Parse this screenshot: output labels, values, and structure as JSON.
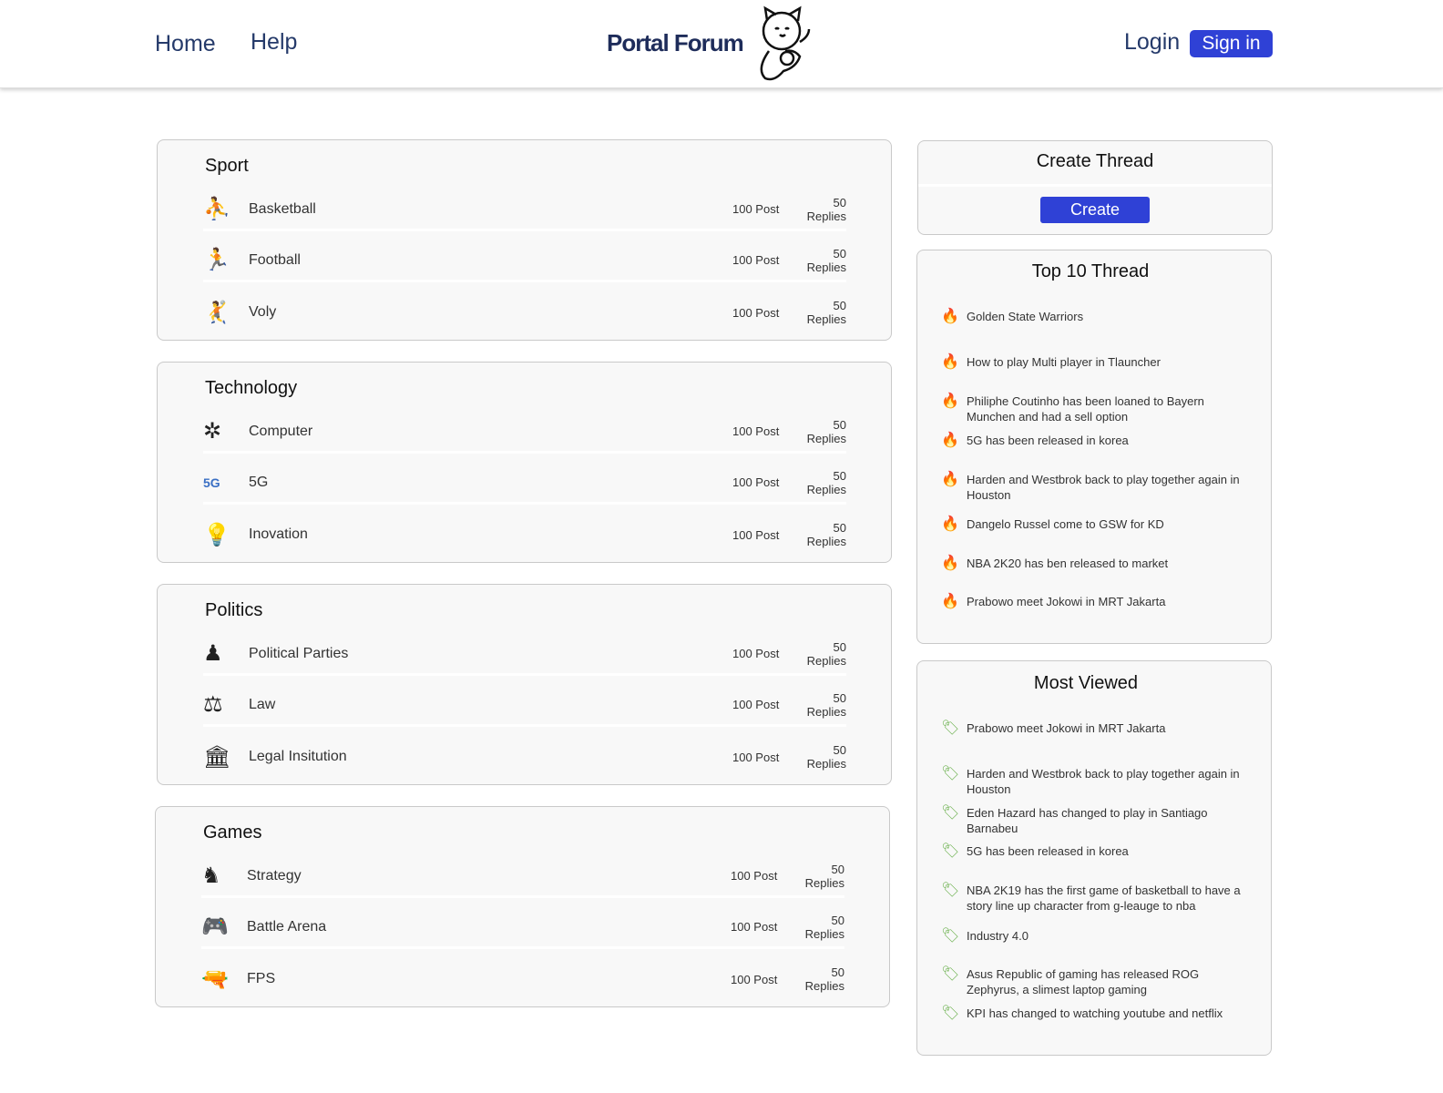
{
  "nav": {
    "home": "Home",
    "help": "Help",
    "brand": "Portal Forum",
    "login": "Login",
    "signin": "Sign in"
  },
  "categories": [
    {
      "title": "Sport",
      "items": [
        {
          "name": "Basketball",
          "icon": "basketball-player-icon",
          "posts": "100 Post",
          "replies": "50 Replies"
        },
        {
          "name": "Football",
          "icon": "football-player-icon",
          "posts": "100 Post",
          "replies": "50 Replies"
        },
        {
          "name": "Voly",
          "icon": "volleyball-player-icon",
          "posts": "100 Post",
          "replies": "50 Replies"
        }
      ]
    },
    {
      "title": "Technology",
      "items": [
        {
          "name": "Computer",
          "icon": "chip-icon",
          "posts": "100 Post",
          "replies": "50 Replies"
        },
        {
          "name": "5G",
          "icon": "5g-icon",
          "posts": "100 Post",
          "replies": "50 Replies"
        },
        {
          "name": "Inovation",
          "icon": "lightbulb-icon",
          "posts": "100 Post",
          "replies": "50 Replies"
        }
      ]
    },
    {
      "title": "Politics",
      "items": [
        {
          "name": "Political Parties",
          "icon": "crowd-icon",
          "posts": "100 Post",
          "replies": "50 Replies"
        },
        {
          "name": "Law",
          "icon": "scales-icon",
          "posts": "100 Post",
          "replies": "50 Replies"
        },
        {
          "name": "Legal Insitution",
          "icon": "building-icon",
          "posts": "100 Post",
          "replies": "50 Replies"
        }
      ]
    },
    {
      "title": "Games",
      "items": [
        {
          "name": "Strategy",
          "icon": "chess-knight-icon",
          "posts": "100 Post",
          "replies": "50 Replies"
        },
        {
          "name": "Battle Arena",
          "icon": "gamepad-icon",
          "posts": "100 Post",
          "replies": "50 Replies"
        },
        {
          "name": "FPS",
          "icon": "gun-icon",
          "posts": "100 Post",
          "replies": "50 Replies"
        }
      ]
    }
  ],
  "create_thread": {
    "title": "Create Thread",
    "button": "Create"
  },
  "top10": {
    "title": "Top 10 Thread",
    "items": [
      "Golden State Warriors",
      "How to play Multi player in Tlauncher",
      "Philiphe Coutinho has been loaned to Bayern Munchen and had a sell option",
      "5G has been released in korea",
      "Harden and Westbrok back to play together again in Houston",
      "Dangelo Russel come to GSW for KD",
      "NBA 2K20 has ben released to market",
      "Prabowo meet Jokowi in MRT Jakarta"
    ]
  },
  "most_viewed": {
    "title": "Most Viewed",
    "items": [
      "Prabowo meet Jokowi in MRT Jakarta",
      "Harden and Westbrok back to play together again in Houston",
      "Eden Hazard has changed to play in Santiago Barnabeu",
      "5G has been released in korea",
      "NBA 2K19 has the first game of basketball to have a story line up character from g-leauge to nba",
      "Industry 4.0",
      "Asus Republic of gaming has released ROG Zephyrus, a slimest laptop gaming",
      "KPI has changed to watching youtube and netflix"
    ]
  }
}
